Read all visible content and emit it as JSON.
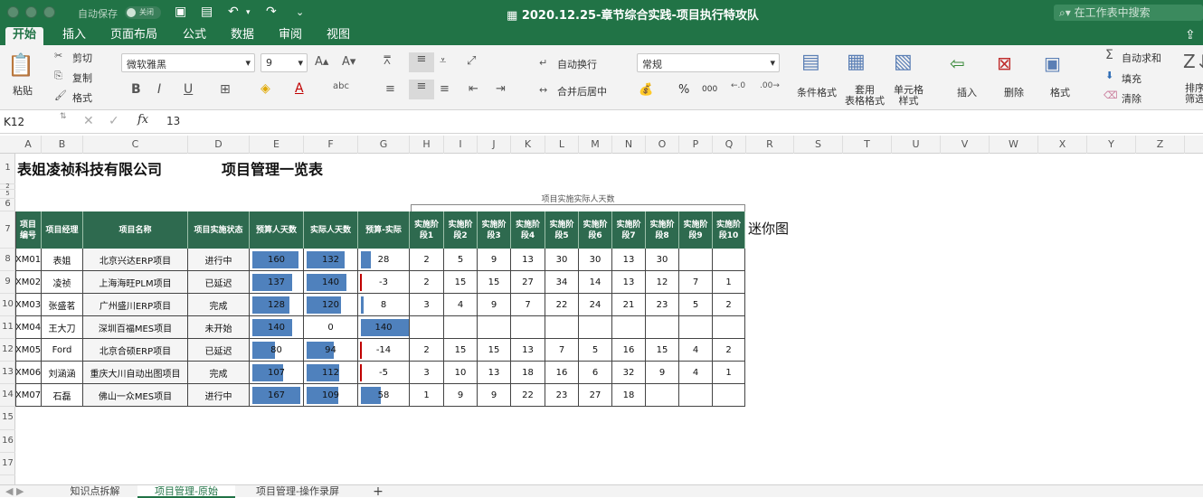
{
  "titlebar": {
    "autosave": "自动保存",
    "toggle": "关闭",
    "title": "2020.12.25-章节综合实践-项目执行特攻队",
    "search_placeholder": "在工作表中搜索"
  },
  "ribbon_tabs": [
    "开始",
    "插入",
    "页面布局",
    "公式",
    "数据",
    "审阅",
    "视图"
  ],
  "ribbon": {
    "paste": "粘贴",
    "cut": "剪切",
    "copy": "复制",
    "format_painter": "格式",
    "font_name": "微软雅黑",
    "font_size": "9",
    "wrap": "自动换行",
    "merge": "合并后居中",
    "number_format": "常规",
    "percent": "%",
    "thousands": "000",
    "cond_format": "条件格式",
    "table_format": "套用\n表格格式",
    "cell_style": "单元格\n样式",
    "insert": "插入",
    "delete": "删除",
    "format": "格式",
    "autosum": "自动求和",
    "fill": "填充",
    "clear": "清除",
    "sort": "排序\n筛选"
  },
  "formula_bar": {
    "cell_ref": "K12",
    "fx": "fx",
    "value": "13"
  },
  "columns": [
    "A",
    "B",
    "C",
    "D",
    "E",
    "F",
    "G",
    "H",
    "I",
    "J",
    "K",
    "L",
    "M",
    "N",
    "O",
    "P",
    "Q",
    "R",
    "S",
    "T",
    "U",
    "V",
    "W",
    "X",
    "Y",
    "Z"
  ],
  "rows": [
    "1",
    "2",
    "5",
    "6",
    "7",
    "8",
    "9",
    "10",
    "11",
    "12",
    "13",
    "14",
    "15",
    "16",
    "17"
  ],
  "sheet": {
    "company": "表姐凌祯科技有限公司",
    "title": "项目管理一览表",
    "group_header": "项目实施实际人天数",
    "sparkline_label": "迷你图",
    "headers": [
      "项目\n编号",
      "项目经理",
      "项目名称",
      "项目实施状态",
      "预算人天数",
      "实际人天数",
      "预算-实际",
      "实施阶\n段1",
      "实施阶\n段2",
      "实施阶\n段3",
      "实施阶\n段4",
      "实施阶\n段5",
      "实施阶\n段6",
      "实施阶\n段7",
      "实施阶\n段8",
      "实施阶\n段9",
      "实施阶\n段10"
    ],
    "rows": [
      {
        "id": "XM01",
        "mgr": "表姐",
        "name": "北京兴达ERP项目",
        "status": "进行中",
        "budget": 160,
        "actual": 132,
        "diff": "28",
        "stages": [
          "2",
          "5",
          "9",
          "13",
          "30",
          "30",
          "13",
          "30",
          "",
          ""
        ]
      },
      {
        "id": "XM02",
        "mgr": "凌祯",
        "name": "上海海旺PLM项目",
        "status": "已延迟",
        "budget": 137,
        "actual": 140,
        "diff": "-3",
        "stages": [
          "2",
          "15",
          "15",
          "27",
          "34",
          "14",
          "13",
          "12",
          "7",
          "1"
        ]
      },
      {
        "id": "XM03",
        "mgr": "张盛茗",
        "name": "广州盛川ERP项目",
        "status": "完成",
        "budget": 128,
        "actual": 120,
        "diff": "8",
        "stages": [
          "3",
          "4",
          "9",
          "7",
          "22",
          "24",
          "21",
          "23",
          "5",
          "2"
        ]
      },
      {
        "id": "XM04",
        "mgr": "王大刀",
        "name": "深圳百福MES项目",
        "status": "未开始",
        "budget": 140,
        "actual": 0,
        "diff": "140",
        "stages": [
          "",
          "",
          "",
          "",
          "",
          "",
          "",
          "",
          "",
          ""
        ]
      },
      {
        "id": "XM05",
        "mgr": "Ford",
        "name": "北京合硕ERP项目",
        "status": "已延迟",
        "budget": 80,
        "actual": 94,
        "diff": "-14",
        "stages": [
          "2",
          "15",
          "15",
          "13",
          "7",
          "5",
          "16",
          "15",
          "4",
          "2"
        ]
      },
      {
        "id": "XM06",
        "mgr": "刘涵涵",
        "name": "重庆大川自动出图项目",
        "status": "完成",
        "budget": 107,
        "actual": 112,
        "diff": "-5",
        "stages": [
          "3",
          "10",
          "13",
          "18",
          "16",
          "6",
          "32",
          "9",
          "4",
          "1"
        ]
      },
      {
        "id": "XM07",
        "mgr": "石磊",
        "name": "佛山一众MES项目",
        "status": "进行中",
        "budget": 167,
        "actual": 109,
        "diff": "58",
        "stages": [
          "1",
          "9",
          "9",
          "22",
          "23",
          "27",
          "18",
          "",
          "",
          ""
        ]
      }
    ]
  },
  "sheet_tabs": [
    "知识点拆解",
    "项目管理-原始",
    "项目管理-操作录屏",
    "+"
  ],
  "colors": {
    "accent": "#217346",
    "header_fill": "#2e6a4f",
    "databar": "#4f81bd",
    "negative": "#c00000"
  }
}
